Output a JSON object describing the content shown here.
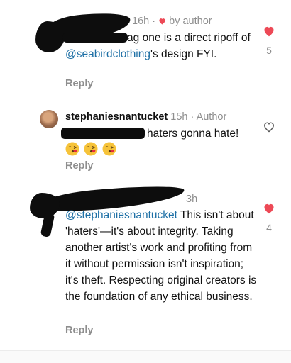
{
  "comments": [
    {
      "time": "16h",
      "liked_by_author": "by author",
      "text_prefix": "he nautical flag one is a direct ripoff of ",
      "mention": "@seabirdclothing",
      "text_suffix": "'s design FYI.",
      "reply_label": "Reply",
      "likes": "5",
      "liked": true
    },
    {
      "username": "stephaniesnantucket",
      "time": "15h",
      "author_badge": "· Author",
      "text": "haters gonna hate!",
      "emojis": [
        "kissing-face",
        "kissing-face",
        "kissing-face"
      ],
      "reply_label": "Reply",
      "liked": false
    },
    {
      "time": "3h",
      "mention": "@stephaniesnantucket",
      "text": " This isn't about 'haters'—it's about integrity. Taking another artist's work and profiting from it without permission isn't inspiration; it's theft. Respecting original creators is the foundation of any ethical business.",
      "reply_label": "Reply",
      "likes": "4",
      "liked": true
    }
  ],
  "colors": {
    "heart_red": "#ed4956",
    "mention_blue": "#1d6fa5",
    "meta_gray": "#8e8e8e"
  }
}
